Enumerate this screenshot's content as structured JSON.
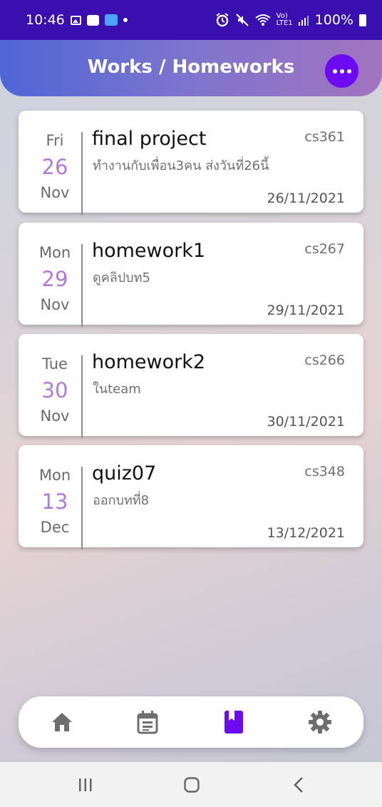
{
  "status_bar": {
    "time": "10:46",
    "battery": "100%",
    "network": "Vo) LTE1"
  },
  "header": {
    "title": "Works / Homeworks",
    "menu_icon": "more-horizontal-icon",
    "accent": "#6c0bf2"
  },
  "cards": [
    {
      "weekday": "Fri",
      "day": "26",
      "month": "Nov",
      "title": "final project",
      "course": "cs361",
      "description": "ทำงานกับเพื่อน3คน ส่งวันที่26นี้",
      "due_date": "26/11/2021"
    },
    {
      "weekday": "Mon",
      "day": "29",
      "month": "Nov",
      "title": "homework1",
      "course": "cs267",
      "description": "ดูคลิปบท5",
      "due_date": "29/11/2021"
    },
    {
      "weekday": "Tue",
      "day": "30",
      "month": "Nov",
      "title": "homework2",
      "course": "cs266",
      "description": "ในteam",
      "due_date": "30/11/2021"
    },
    {
      "weekday": "Mon",
      "day": "13",
      "month": "Dec",
      "title": "quiz07",
      "course": "cs348",
      "description": "ออกบทที่8",
      "due_date": "13/12/2021"
    }
  ],
  "bottom_nav": {
    "items": [
      {
        "icon": "home-icon",
        "active": false
      },
      {
        "icon": "calendar-icon",
        "active": false
      },
      {
        "icon": "book-icon",
        "active": true
      },
      {
        "icon": "gear-icon",
        "active": false
      }
    ],
    "active_color": "#6c0bf2",
    "inactive_color": "#6e6e6e"
  },
  "system_nav": {
    "items": [
      "recents-icon",
      "home-circle-icon",
      "back-icon"
    ]
  }
}
